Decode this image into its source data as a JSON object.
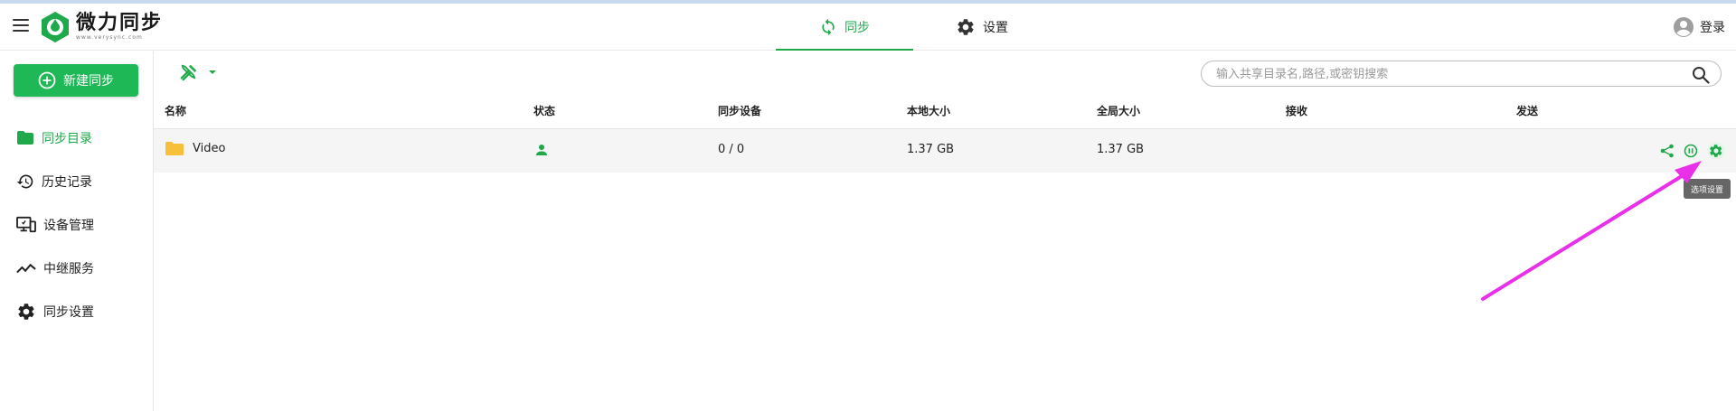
{
  "app": {
    "logo_name": "微力同步",
    "logo_url": "www.verysync.com"
  },
  "header": {
    "tabs": [
      {
        "label": "同步",
        "icon": "sync-icon",
        "active": true
      },
      {
        "label": "设置",
        "icon": "gear-icon",
        "active": false
      }
    ],
    "login_label": "登录"
  },
  "sidebar": {
    "new_sync_label": "新建同步",
    "items": [
      {
        "label": "同步目录",
        "icon": "folder-icon",
        "active": true
      },
      {
        "label": "历史记录",
        "icon": "history-icon",
        "active": false
      },
      {
        "label": "设备管理",
        "icon": "device-icon",
        "active": false
      },
      {
        "label": "中继服务",
        "icon": "relay-icon",
        "active": false
      },
      {
        "label": "同步设置",
        "icon": "gear-icon",
        "active": false
      }
    ]
  },
  "search": {
    "placeholder": "输入共享目录名,路径,或密钥搜索",
    "value": ""
  },
  "table": {
    "columns": [
      "名称",
      "状态",
      "同步设备",
      "本地大小",
      "全局大小",
      "接收",
      "发送"
    ],
    "rows": [
      {
        "name": "Video",
        "status_icon": "user-icon",
        "devices": "0 / 0",
        "local_size": "1.37 GB",
        "global_size": "1.37 GB",
        "receive": "",
        "send": ""
      }
    ]
  },
  "tooltip": "选项设置",
  "colors": {
    "accent": "#1fa94a",
    "button": "#1fb856",
    "folder": "#f7c03a",
    "annotation_arrow": "#e830e8"
  }
}
